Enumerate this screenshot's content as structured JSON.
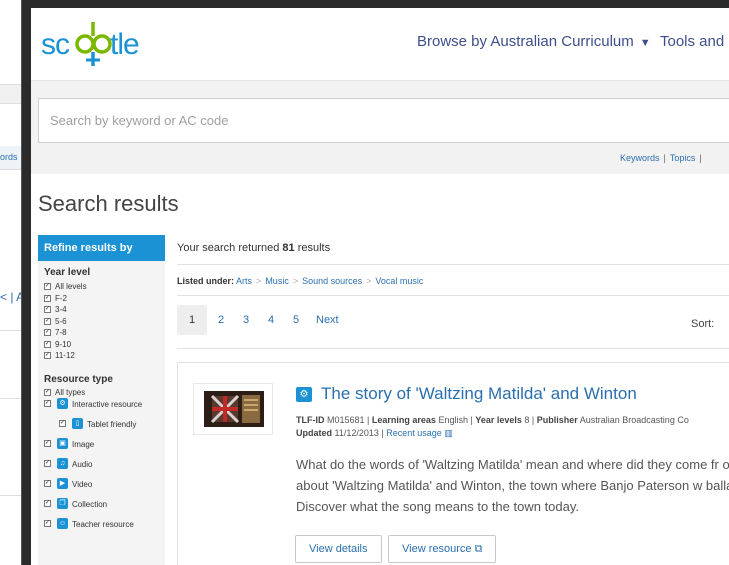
{
  "left_window": {
    "crop_link_text": "ords",
    "crop_text2": "< | A"
  },
  "header": {
    "logo_text": "scootle",
    "nav_browse": "Browse by Australian Curriculum",
    "nav_tools": "Tools and"
  },
  "search": {
    "placeholder": "Search by keyword or AC code",
    "links": [
      "Keywords",
      "Topics"
    ]
  },
  "page_title": "Search results",
  "refine": {
    "heading": "Refine results by",
    "year_level": {
      "title": "Year level",
      "items": [
        "All levels",
        "F-2",
        "3-4",
        "5-6",
        "7-8",
        "9-10",
        "11-12"
      ]
    },
    "resource_type": {
      "title": "Resource type",
      "all": "All types",
      "items": [
        {
          "label": "Interactive resource",
          "sub": false
        },
        {
          "label": "Tablet friendly",
          "sub": true
        },
        {
          "label": "Image",
          "sub": false
        },
        {
          "label": "Audio",
          "sub": false
        },
        {
          "label": "Video",
          "sub": false
        },
        {
          "label": "Collection",
          "sub": false
        },
        {
          "label": "Teacher resource",
          "sub": false
        }
      ]
    }
  },
  "results": {
    "returned_prefix": "Your search returned",
    "count": "81",
    "returned_suffix": "results",
    "listed_label": "Listed under:",
    "breadcrumb": [
      "Arts",
      "Music",
      "Sound sources",
      "Vocal music"
    ],
    "pages": [
      "1",
      "2",
      "3",
      "4",
      "5",
      "Next"
    ],
    "sort_label": "Sort:"
  },
  "item": {
    "title": "The story of 'Waltzing Matilda' and Winton",
    "tlf_label": "TLF-ID",
    "tlf_id": "M015681",
    "learning_label": "Learning areas",
    "learning_value": "English",
    "year_label": "Year levels",
    "year_value": "8",
    "publisher_label": "Publisher",
    "publisher_value": "Australian Broadcasting Co",
    "updated_label": "Updated",
    "updated_value": "11/12/2013",
    "recent_usage": "Recent usage",
    "description": "What do the words of 'Waltzing Matilda' mean and where did they come fr out about 'Waltzing Matilda' and Winton, the town where Banjo Paterson w ballad. Discover what the song means to the town today.",
    "btn_details": "View details",
    "btn_resource": "View resource"
  },
  "colors": {
    "brand_green": "#7ab800",
    "brand_blue": "#1a92d4",
    "link": "#2a6fb0",
    "nav": "#3e4f8c"
  }
}
